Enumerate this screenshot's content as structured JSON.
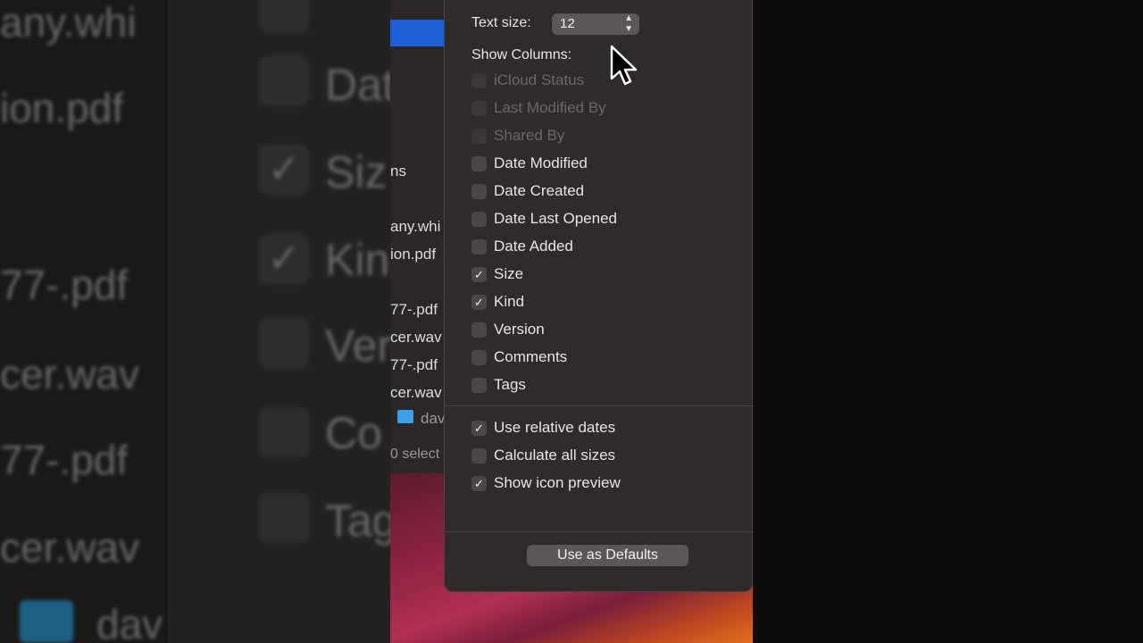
{
  "popover": {
    "text_size_label": "Text size:",
    "text_size_value": "12",
    "show_columns_label": "Show Columns:",
    "columns": [
      {
        "label": "iCloud Status",
        "checked": false,
        "disabled": true
      },
      {
        "label": "Last Modified By",
        "checked": false,
        "disabled": true
      },
      {
        "label": "Shared By",
        "checked": false,
        "disabled": true
      },
      {
        "label": "Date Modified",
        "checked": false,
        "disabled": false
      },
      {
        "label": "Date Created",
        "checked": false,
        "disabled": false
      },
      {
        "label": "Date Last Opened",
        "checked": false,
        "disabled": false
      },
      {
        "label": "Date Added",
        "checked": false,
        "disabled": false
      },
      {
        "label": "Size",
        "checked": true,
        "disabled": false
      },
      {
        "label": "Kind",
        "checked": true,
        "disabled": false
      },
      {
        "label": "Version",
        "checked": false,
        "disabled": false
      },
      {
        "label": "Comments",
        "checked": false,
        "disabled": false
      },
      {
        "label": "Tags",
        "checked": false,
        "disabled": false
      }
    ],
    "options": [
      {
        "label": "Use relative dates",
        "checked": true
      },
      {
        "label": "Calculate all sizes",
        "checked": false
      },
      {
        "label": "Show icon preview",
        "checked": true
      }
    ],
    "defaults_button": "Use as Defaults"
  },
  "finder_fragments": {
    "columns_fragment": "ns",
    "files": [
      "any.whi",
      "ion.pdf",
      "77-.pdf",
      "cer.wav",
      "77-.pdf",
      "cer.wav"
    ],
    "folder": "dav",
    "status": "0 select"
  },
  "background_fragments": {
    "files": [
      "any.whi",
      "ion.pdf",
      "77-.pdf",
      "cer.wav",
      "77-.pdf",
      "cer.wav",
      "dav"
    ],
    "labels": [
      "Dat",
      "Siz",
      "Kin",
      "Ver",
      "Co",
      "Tag"
    ]
  }
}
